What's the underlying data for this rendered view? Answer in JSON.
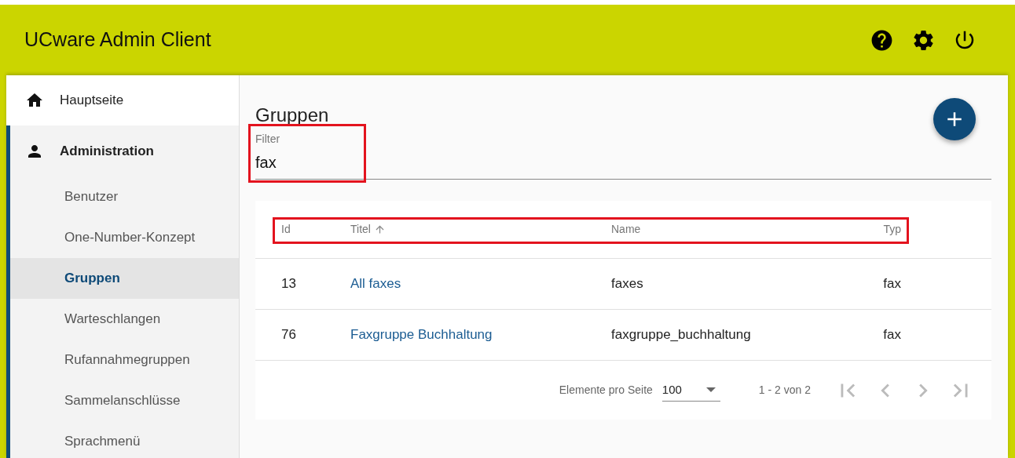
{
  "app_bar": {
    "title": "UCware Admin Client"
  },
  "sidebar": {
    "items": [
      {
        "label": "Hauptseite",
        "kind": "top",
        "selected": false,
        "expanded": false
      },
      {
        "label": "Administration",
        "kind": "section",
        "selected": false,
        "expanded": true,
        "children": [
          {
            "label": "Benutzer",
            "selected": false
          },
          {
            "label": "One-Number-Konzept",
            "selected": false
          },
          {
            "label": "Gruppen",
            "selected": true
          },
          {
            "label": "Warteschlangen",
            "selected": false
          },
          {
            "label": "Rufannahmegruppen",
            "selected": false
          },
          {
            "label": "Sammelanschlüsse",
            "selected": false
          },
          {
            "label": "Sprachmenü",
            "selected": false
          }
        ]
      }
    ]
  },
  "page": {
    "title": "Gruppen",
    "filter": {
      "label": "Filter",
      "value": "fax",
      "highlighted": true
    },
    "table": {
      "header_highlighted": true,
      "columns": [
        {
          "label": "Id",
          "sorted": false
        },
        {
          "label": "Titel",
          "sorted": true
        },
        {
          "label": "Name",
          "sorted": false
        },
        {
          "label": "Typ",
          "sorted": false
        }
      ],
      "rows": [
        [
          "13",
          "All faxes",
          "faxes",
          "fax"
        ],
        [
          "76",
          "Faxgruppe Buchhaltung",
          "faxgruppe_buchhaltung",
          "fax"
        ]
      ]
    },
    "paginator": {
      "label": "Elemente pro Seite",
      "page_size": "100",
      "range": "1 - 2 von 2"
    }
  }
}
